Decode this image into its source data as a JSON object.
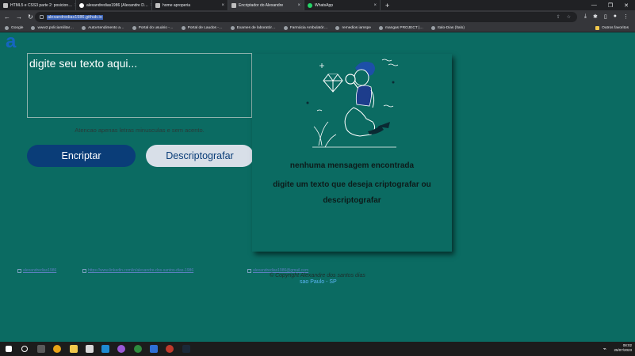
{
  "browser": {
    "tabs": [
      {
        "title": "HTML5 e CSS3 parte 2: posicion…",
        "icon": "page-icon",
        "active": false
      },
      {
        "title": "alexandredias1986 (Alexandre D…",
        "icon": "github-icon",
        "active": false
      },
      {
        "title": "home aproperia",
        "icon": "page-icon",
        "active": false
      },
      {
        "title": "Encriptador do Alexandre",
        "icon": "page-icon",
        "active": true
      },
      {
        "title": "WhatsApp",
        "icon": "whatsapp-icon",
        "active": false
      }
    ],
    "new_tab": "+",
    "url": "alexandredias1986.github.io",
    "bookmarks": [
      {
        "label": "Google",
        "type": "site"
      },
      {
        "label": "www2.policiamilitar…",
        "type": "site"
      },
      {
        "label": "AutoAtendimento a…",
        "type": "site"
      },
      {
        "label": "Portal do usuário -…",
        "type": "site"
      },
      {
        "label": "Portal de Laudos -…",
        "type": "site"
      },
      {
        "label": "Exames de laboratór…",
        "type": "site"
      },
      {
        "label": "Farmácia Ambulatór…",
        "type": "site"
      },
      {
        "label": "remedios iamspe",
        "type": "site"
      },
      {
        "label": "mangas PROJECT |…",
        "type": "site"
      },
      {
        "label": "Italo-Dias (Ítalo)",
        "type": "site"
      }
    ],
    "other_bookmarks": "Outros favoritos"
  },
  "page": {
    "logo": "a",
    "textarea_placeholder": "digite seu texto aqui...",
    "hint": "Atencao apenas letras minusculas e sem acento.",
    "encrypt_button": "Encriptar",
    "decrypt_button": "Descriptografar",
    "no_message_title": "nenhuma mensagem encontrada",
    "no_message_text": "digite um texto que deseja criptografar ou descriptografar",
    "footer_links": [
      "alexandredias1986",
      "https://www.linkedin.com/in/alexandre-dos-santos-dias-1986",
      "alexandredias1986@gmail.com"
    ],
    "copyright": "© Copyright Alexandre dos santos dias",
    "city": "sao Paulo - SP"
  },
  "taskbar": {
    "time": "08:02",
    "date": "25/07/2023"
  },
  "colors": {
    "page_background": "#0b6b62",
    "primary_button": "#0a3d78",
    "secondary_button": "#d8dfe8",
    "link": "#5ab4f2"
  }
}
